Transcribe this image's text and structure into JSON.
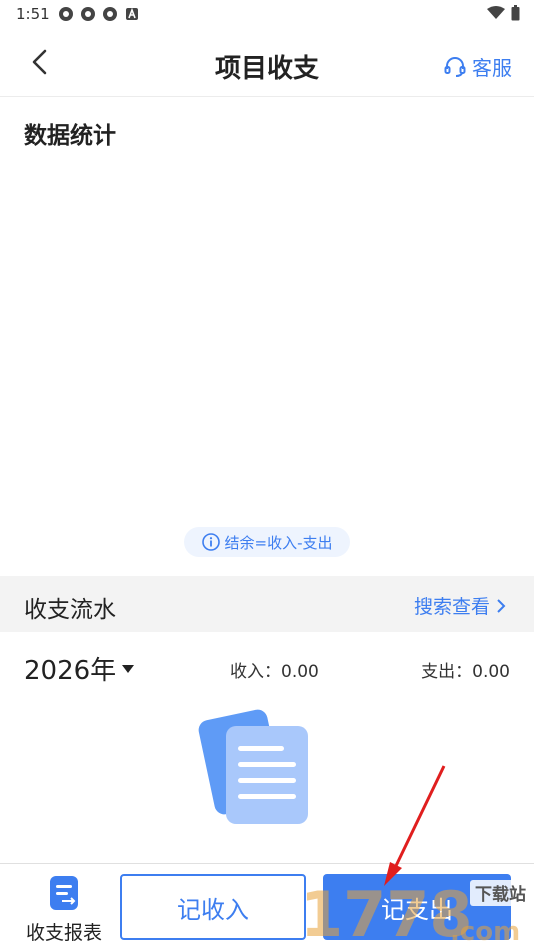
{
  "status_bar": {
    "time": "1:51",
    "icons": [
      "app-notification-icon",
      "app-notification-icon",
      "app-notification-icon",
      "a-badge-icon"
    ],
    "right_icons": [
      "wifi-icon",
      "battery-icon"
    ]
  },
  "nav": {
    "back_icon": "chevron-left-icon",
    "title": "项目收支",
    "service_icon": "headset-icon",
    "service_label": "客服"
  },
  "stats": {
    "title": "数据统计",
    "note_icon": "info-icon",
    "note": "结余=收入-支出"
  },
  "flow": {
    "title": "收支流水",
    "search_label": "搜索查看",
    "search_icon": "chevron-right-icon"
  },
  "summary": {
    "year": "2026年",
    "income": "收入：0.00",
    "expense": "支出：0.00"
  },
  "empty_state": {
    "icon": "document-stack-icon"
  },
  "bottom_bar": {
    "report_label": "收支报表",
    "report_icon": "report-icon",
    "income_button": "记收入",
    "expense_button": "记支出"
  },
  "overlay": {
    "watermark": "1778.com",
    "watermark_sub": "下载站"
  },
  "colors": {
    "accent": "#3d7ef0",
    "flow_bg": "#f3f3f3",
    "note_bg": "#eef4fe",
    "arrow": "#e01e1e"
  }
}
